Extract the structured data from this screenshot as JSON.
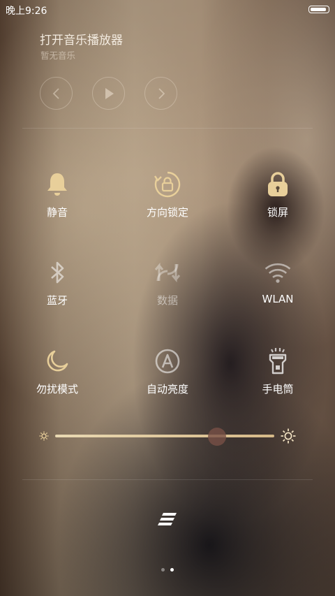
{
  "status_bar": {
    "time": "晚上9:26",
    "battery_level": 1.0
  },
  "music": {
    "title": "打开音乐播放器",
    "subtitle": "暂无音乐"
  },
  "toggles": [
    {
      "label": "静音",
      "icon": "bell-icon",
      "active": true
    },
    {
      "label": "方向锁定",
      "icon": "rotation-lock-icon",
      "active": true
    },
    {
      "label": "锁屏",
      "icon": "lock-icon",
      "active": true
    },
    {
      "label": "蓝牙",
      "icon": "bluetooth-icon",
      "active": false
    },
    {
      "label": "数据",
      "icon": "mobile-data-icon",
      "active": false
    },
    {
      "label": "WLAN",
      "icon": "wifi-icon",
      "active": false
    },
    {
      "label": "勿扰模式",
      "icon": "moon-icon",
      "active": true
    },
    {
      "label": "自动亮度",
      "icon": "auto-brightness-icon",
      "active": false
    },
    {
      "label": "手电筒",
      "icon": "flashlight-icon",
      "active": false
    }
  ],
  "brightness": {
    "level": 0.74
  },
  "pager": {
    "pages": 2,
    "current": 2
  },
  "colors": {
    "accent": "#e8cf9a",
    "inactive": "#ffffff"
  }
}
